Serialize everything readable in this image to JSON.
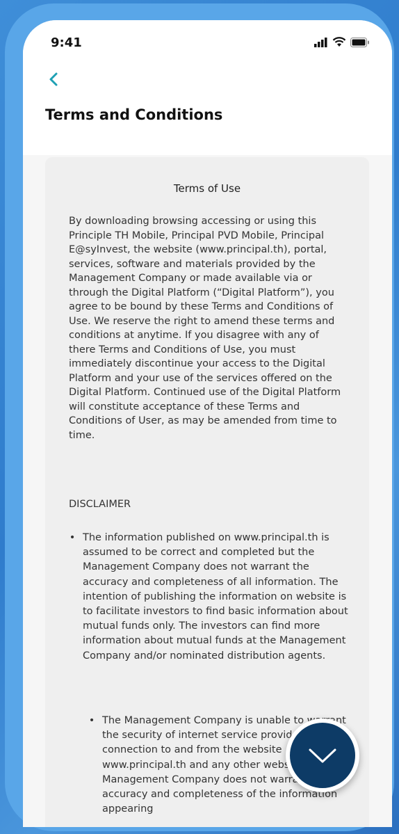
{
  "status_bar": {
    "time": "9:41",
    "icons": [
      "signal-icon",
      "wifi-icon",
      "battery-icon"
    ]
  },
  "header": {
    "back_icon": "chevron-left-icon",
    "title": "Terms and Conditions"
  },
  "document": {
    "title": "Terms of Use",
    "intro": "By downloading browsing accessing or using this Principle TH Mobile, Principal PVD Mobile, Principal E@syInvest, the website (www.principal.th), portal, services, software and materials provided by the Management Company or made available via or through the Digital Platform (“Digital Platform”), you agree to be bound by these Terms and Conditions of Use. We reserve the right to amend these terms and conditions at anytime. If you disagree with any of there Terms and Conditions of Use, you must immediately discontinue your access to the Digital Platform and your use of the services offered on the Digital Platform. Continued use of the Digital Platform will constitute acceptance of these Terms and Conditions of User, as may be amended from time to time.",
    "disclaimer_heading": "DISCLAIMER",
    "bullets": [
      "The information published on www.principal.th is assumed to be correct and completed but the Management Company does not warrant the accuracy and completeness of all information. The intention of publishing the information on website is to facilitate investors to find basic information about mutual funds only. The investors can find more information about mutual funds at the Management Company and/or nominated distribution agents.",
      "The Management Company is unable to warrant the security of internet service provider, any connection to and from the website www.principal.th and any other website. The Management Company does not warrant the accuracy and completeness of the information appearing"
    ]
  },
  "scroll_button_icon": "chevron-down-icon",
  "colors": {
    "accent": "#1ea0b4",
    "button": "#0d3b66",
    "background": "#3f8ed8"
  }
}
